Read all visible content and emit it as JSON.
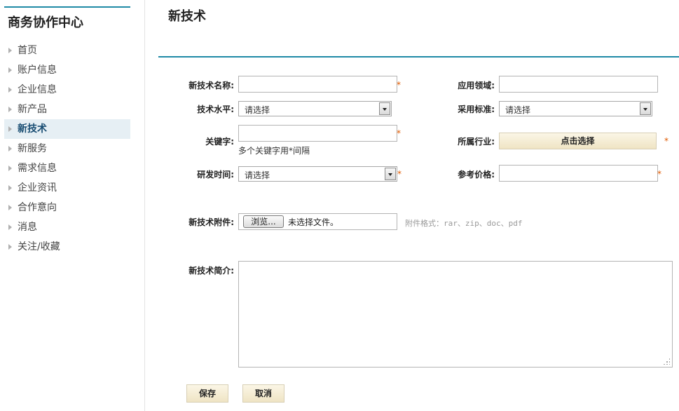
{
  "sidebar": {
    "title": "商务协作中心",
    "items": [
      {
        "label": "首页",
        "active": false
      },
      {
        "label": "账户信息",
        "active": false
      },
      {
        "label": "企业信息",
        "active": false
      },
      {
        "label": "新产品",
        "active": false
      },
      {
        "label": "新技术",
        "active": true
      },
      {
        "label": "新服务",
        "active": false
      },
      {
        "label": "需求信息",
        "active": false
      },
      {
        "label": "企业资讯",
        "active": false
      },
      {
        "label": "合作意向",
        "active": false
      },
      {
        "label": "消息",
        "active": false
      },
      {
        "label": "关注/收藏",
        "active": false
      }
    ]
  },
  "main": {
    "title": "新技术",
    "form": {
      "tech_name": {
        "label": "新技术名称:",
        "value": "",
        "required": "*"
      },
      "application_field": {
        "label": "应用领域:",
        "value": ""
      },
      "tech_level": {
        "label": "技术水平:",
        "selected": "请选择"
      },
      "standard": {
        "label": "采用标准:",
        "selected": "请选择"
      },
      "keywords": {
        "label": "关键字:",
        "value": "",
        "required": "*",
        "hint": "多个关键字用*间隔"
      },
      "industry": {
        "label": "所属行业:",
        "button": "点击选择",
        "required": "*"
      },
      "rd_time": {
        "label": "研发时间:",
        "selected": "请选择",
        "required": "*"
      },
      "price": {
        "label": "参考价格:",
        "value": "",
        "required": "*"
      },
      "attachment": {
        "label": "新技术附件:",
        "browse": "浏览...",
        "no_file": "未选择文件。",
        "format_hint": "附件格式：rar、zip、doc、pdf"
      },
      "intro": {
        "label": "新技术简介:",
        "value": ""
      }
    },
    "actions": {
      "save": "保存",
      "cancel": "取消"
    }
  },
  "colors": {
    "accent_line": "#1f8aa6",
    "active_nav_bg": "#e6eff4",
    "required": "#e05a00",
    "button_bg": "#f5ecd2"
  }
}
